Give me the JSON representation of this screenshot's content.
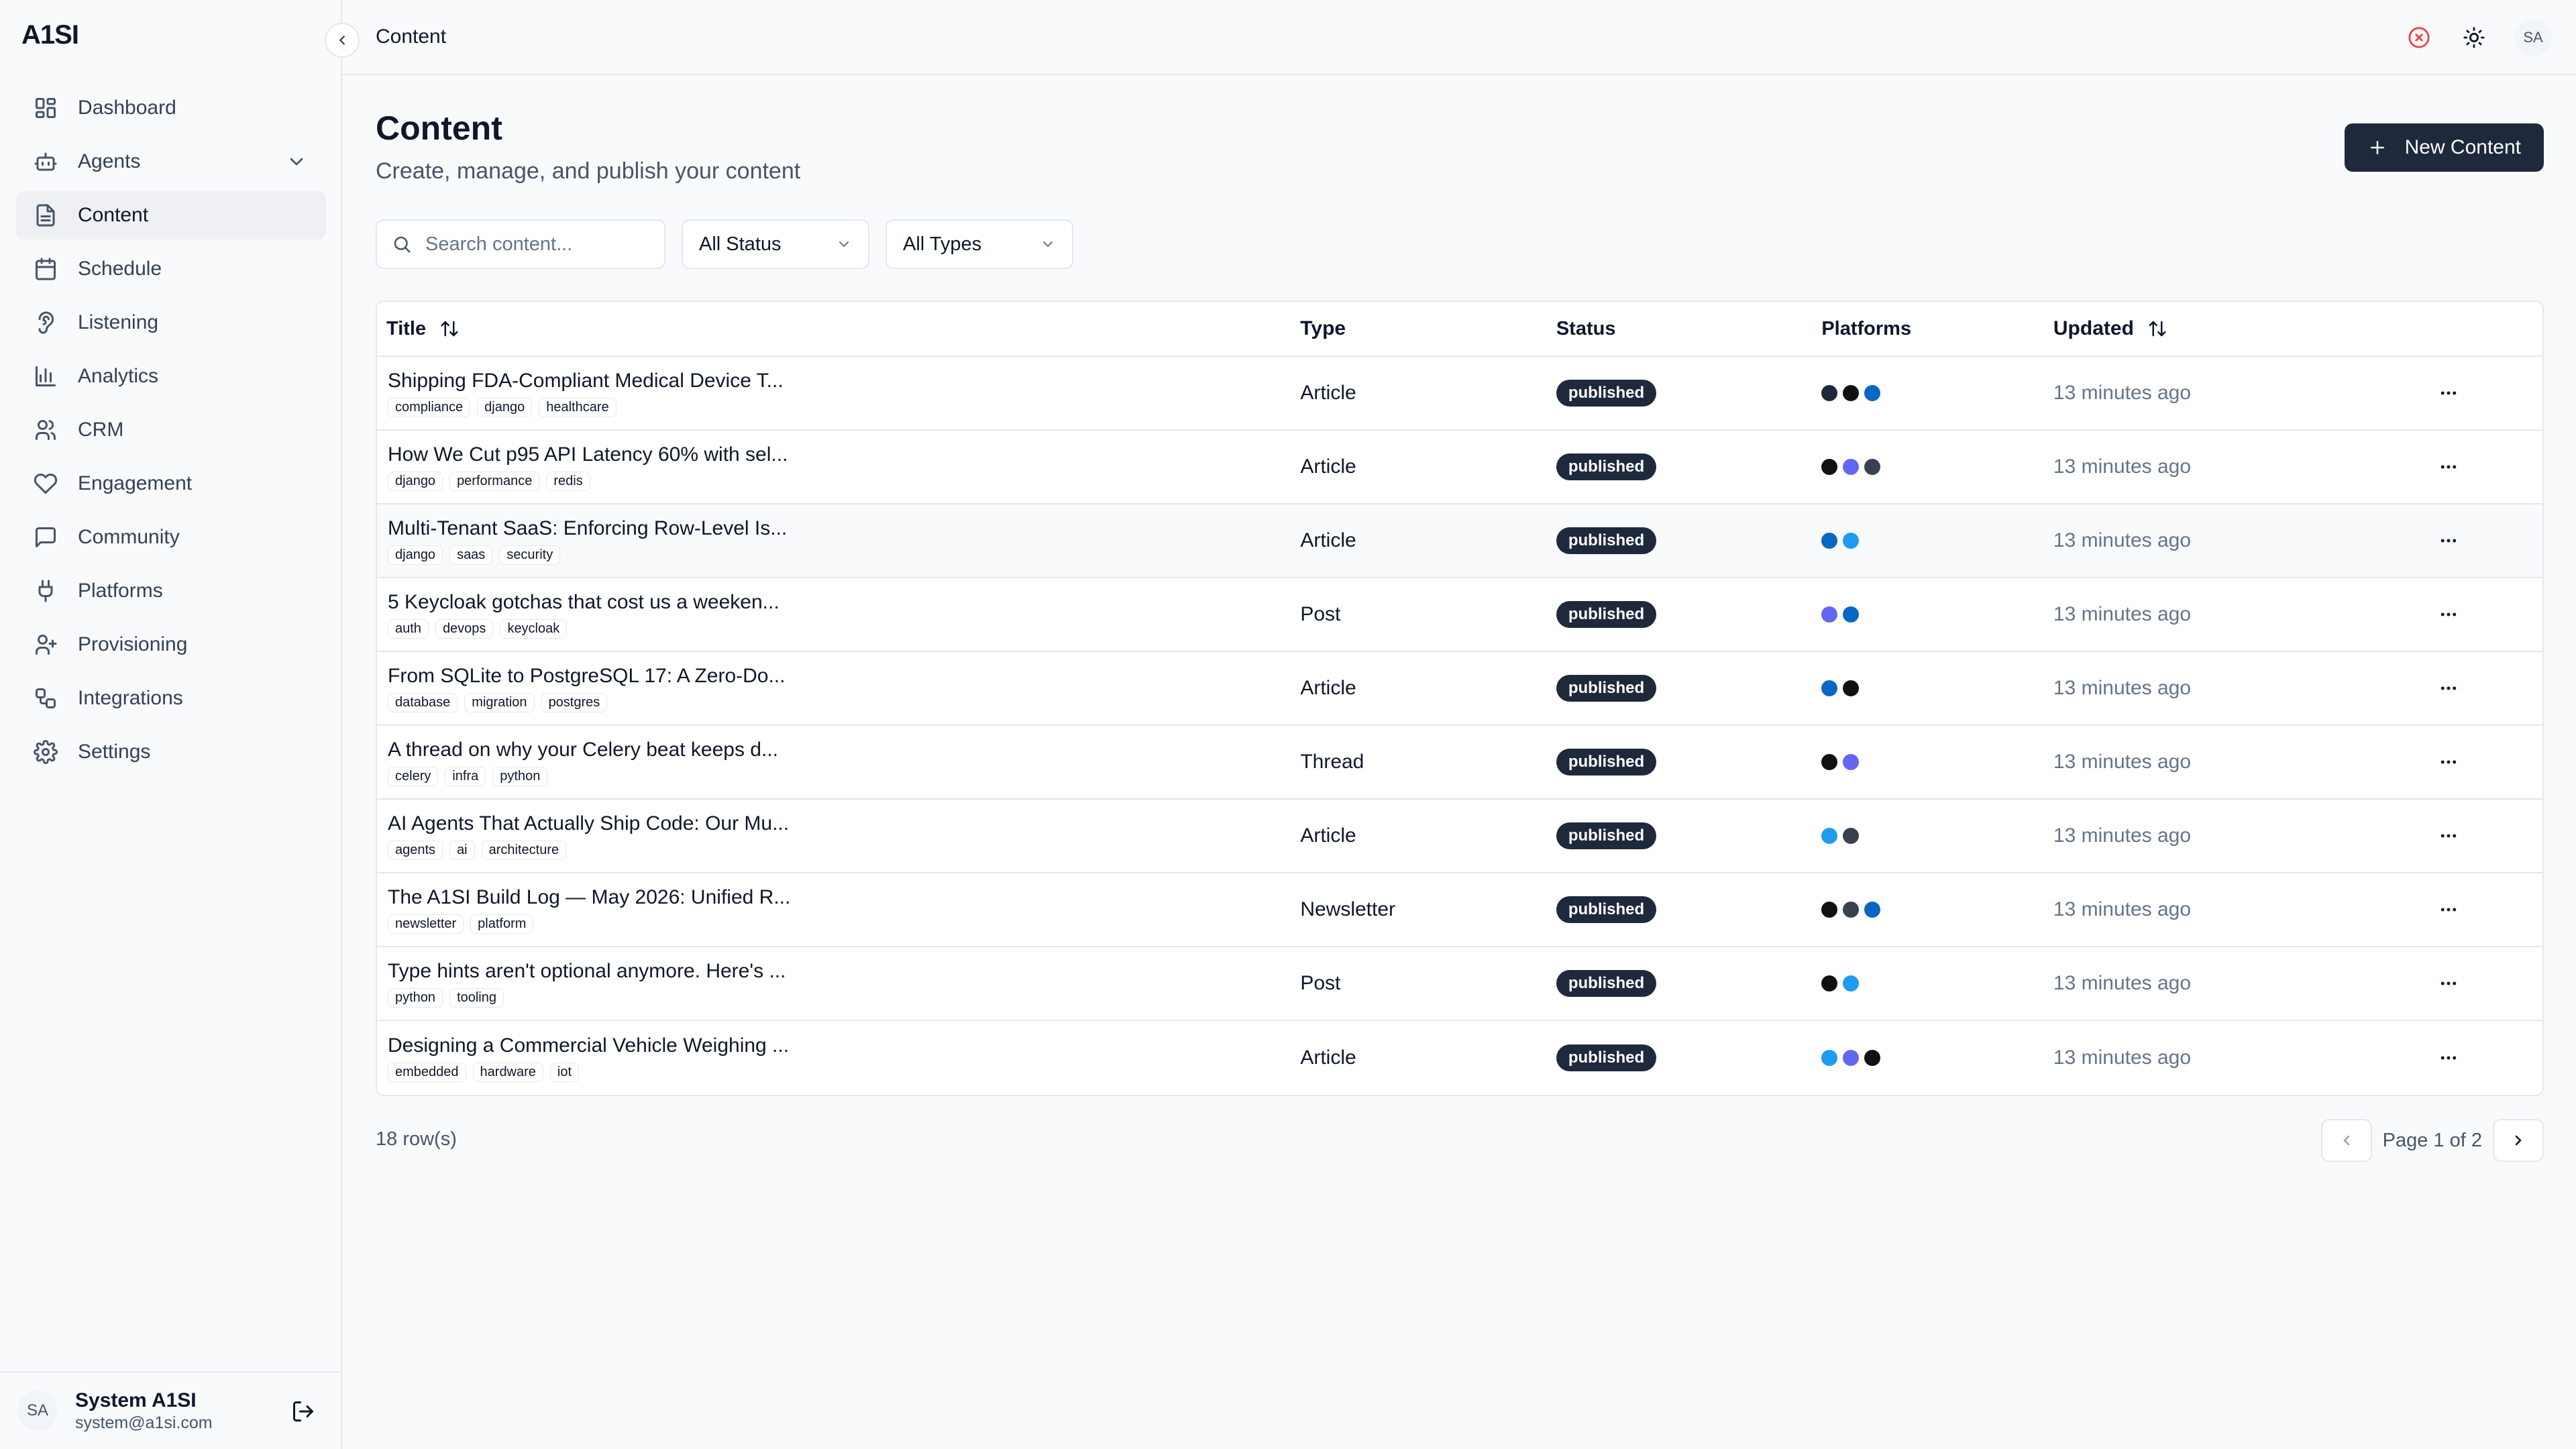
{
  "app": {
    "logo": "A1SI"
  },
  "sidebar": {
    "items": [
      {
        "label": "Dashboard",
        "icon": "dashboard-icon"
      },
      {
        "label": "Agents",
        "icon": "bot-icon",
        "expandable": true
      },
      {
        "label": "Content",
        "icon": "file-text-icon",
        "active": true
      },
      {
        "label": "Schedule",
        "icon": "calendar-icon"
      },
      {
        "label": "Listening",
        "icon": "ear-icon"
      },
      {
        "label": "Analytics",
        "icon": "bar-chart-icon"
      },
      {
        "label": "CRM",
        "icon": "users-icon"
      },
      {
        "label": "Engagement",
        "icon": "heart-icon"
      },
      {
        "label": "Community",
        "icon": "message-square-icon"
      },
      {
        "label": "Platforms",
        "icon": "plug-icon"
      },
      {
        "label": "Provisioning",
        "icon": "user-plus-icon"
      },
      {
        "label": "Integrations",
        "icon": "workflow-icon"
      },
      {
        "label": "Settings",
        "icon": "gear-icon"
      }
    ],
    "user": {
      "initials": "SA",
      "name": "System A1SI",
      "email": "system@a1si.com"
    }
  },
  "topbar": {
    "breadcrumb": "Content",
    "avatar_initials": "SA"
  },
  "page": {
    "title": "Content",
    "subtitle": "Create, manage, and publish your content",
    "new_button": "New Content"
  },
  "filters": {
    "search_placeholder": "Search content...",
    "status": "All Status",
    "type": "All Types"
  },
  "table": {
    "headers": {
      "title": "Title",
      "type": "Type",
      "status": "Status",
      "platforms": "Platforms",
      "updated": "Updated"
    },
    "rows": [
      {
        "title": "Shipping FDA-Compliant Medical Device T...",
        "tags": [
          "compliance",
          "django",
          "healthcare"
        ],
        "type": "Article",
        "status": "published",
        "platforms": [
          "#1f2937",
          "#111111",
          "#0a66c2"
        ],
        "updated": "13 minutes ago"
      },
      {
        "title": "How We Cut p95 API Latency 60% with sel...",
        "tags": [
          "django",
          "performance",
          "redis"
        ],
        "type": "Article",
        "status": "published",
        "platforms": [
          "#111111",
          "#6366f1",
          "#374151"
        ],
        "updated": "13 minutes ago"
      },
      {
        "title": "Multi-Tenant SaaS: Enforcing Row-Level Is...",
        "tags": [
          "django",
          "saas",
          "security"
        ],
        "type": "Article",
        "status": "published",
        "platforms": [
          "#0a66c2",
          "#1d9bf0"
        ],
        "updated": "13 minutes ago",
        "highlight": true
      },
      {
        "title": "5 Keycloak gotchas that cost us a weeken...",
        "tags": [
          "auth",
          "devops",
          "keycloak"
        ],
        "type": "Post",
        "status": "published",
        "platforms": [
          "#6366f1",
          "#0a66c2"
        ],
        "updated": "13 minutes ago"
      },
      {
        "title": "From SQLite to PostgreSQL 17: A Zero-Do...",
        "tags": [
          "database",
          "migration",
          "postgres"
        ],
        "type": "Article",
        "status": "published",
        "platforms": [
          "#0a66c2",
          "#111111"
        ],
        "updated": "13 minutes ago"
      },
      {
        "title": "A thread on why your Celery beat keeps d...",
        "tags": [
          "celery",
          "infra",
          "python"
        ],
        "type": "Thread",
        "status": "published",
        "platforms": [
          "#111111",
          "#6366f1"
        ],
        "updated": "13 minutes ago"
      },
      {
        "title": "AI Agents That Actually Ship Code: Our Mu...",
        "tags": [
          "agents",
          "ai",
          "architecture"
        ],
        "type": "Article",
        "status": "published",
        "platforms": [
          "#1d9bf0",
          "#374151"
        ],
        "updated": "13 minutes ago"
      },
      {
        "title": "The A1SI Build Log — May 2026: Unified R...",
        "tags": [
          "newsletter",
          "platform"
        ],
        "type": "Newsletter",
        "status": "published",
        "platforms": [
          "#111111",
          "#374151",
          "#0a66c2"
        ],
        "updated": "13 minutes ago"
      },
      {
        "title": "Type hints aren't optional anymore. Here's ...",
        "tags": [
          "python",
          "tooling"
        ],
        "type": "Post",
        "status": "published",
        "platforms": [
          "#111111",
          "#1d9bf0"
        ],
        "updated": "13 minutes ago"
      },
      {
        "title": "Designing a Commercial Vehicle Weighing ...",
        "tags": [
          "embedded",
          "hardware",
          "iot"
        ],
        "type": "Article",
        "status": "published",
        "platforms": [
          "#1d9bf0",
          "#6366f1",
          "#111111"
        ],
        "updated": "13 minutes ago"
      }
    ]
  },
  "footer": {
    "row_count": "18 row(s)",
    "page_label": "Page 1 of 2"
  },
  "colors": {
    "accent": "#1e293b",
    "error_icon": "#ef4444"
  }
}
